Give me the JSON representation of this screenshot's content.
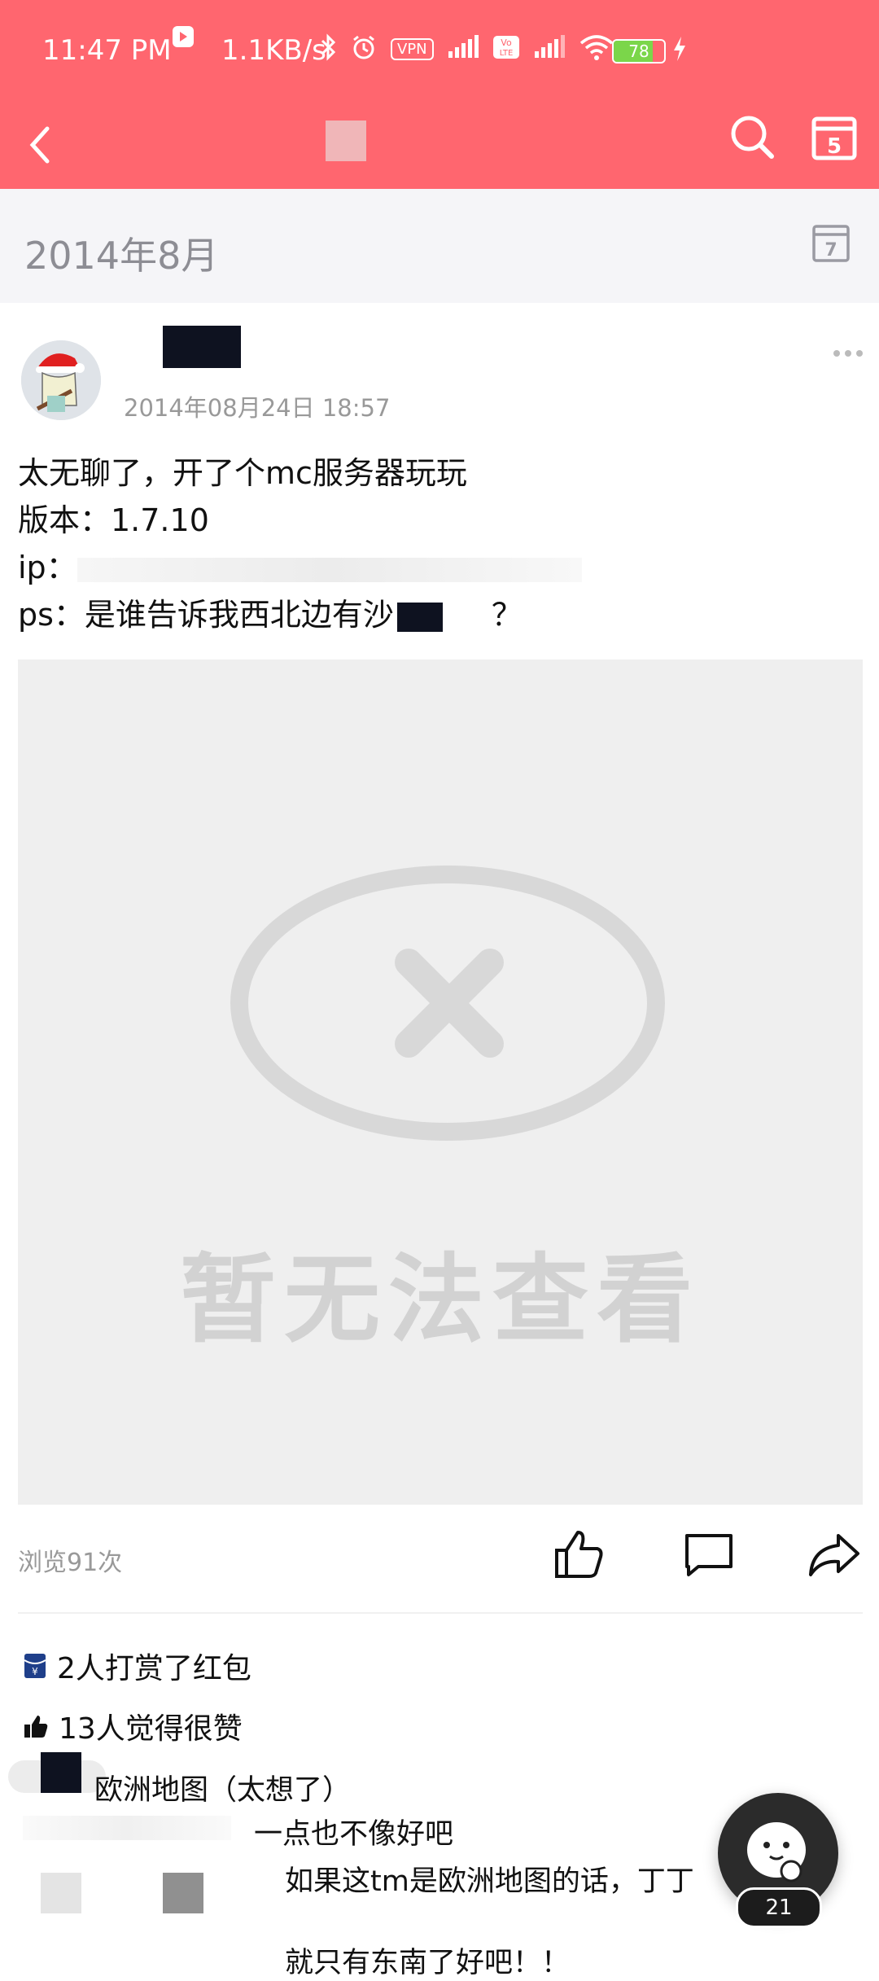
{
  "status_bar": {
    "time": "11:47 PM",
    "speed": "1.1KB/s",
    "vpn": "VPN",
    "battery": "78",
    "battery_level": 0.78
  },
  "month_header": {
    "label": "2014年8月"
  },
  "post": {
    "timestamp": "2014年08月24日 18:57",
    "lines": [
      "太无聊了，开了个mc服务器玩玩",
      "版本：1.7.10",
      "ip：",
      "ps：是谁告诉我西北边有沙"
    ],
    "line4_tail": "？",
    "image_blocked_text": "暂无法查看",
    "views": "浏览91次"
  },
  "reactions": {
    "rewards": "2人打赏了红包",
    "likes": "13人觉得很赞"
  },
  "comments": {
    "c1": "欧洲地图（太想了）",
    "c2": "一点也不像好吧",
    "c3": "如果这tm是欧洲地图的话，丁丁",
    "c4": "就只有东南了好吧！！"
  },
  "fab": {
    "badge": "21"
  },
  "colors": {
    "accent": "#ff666f",
    "muted_text": "#999999"
  }
}
